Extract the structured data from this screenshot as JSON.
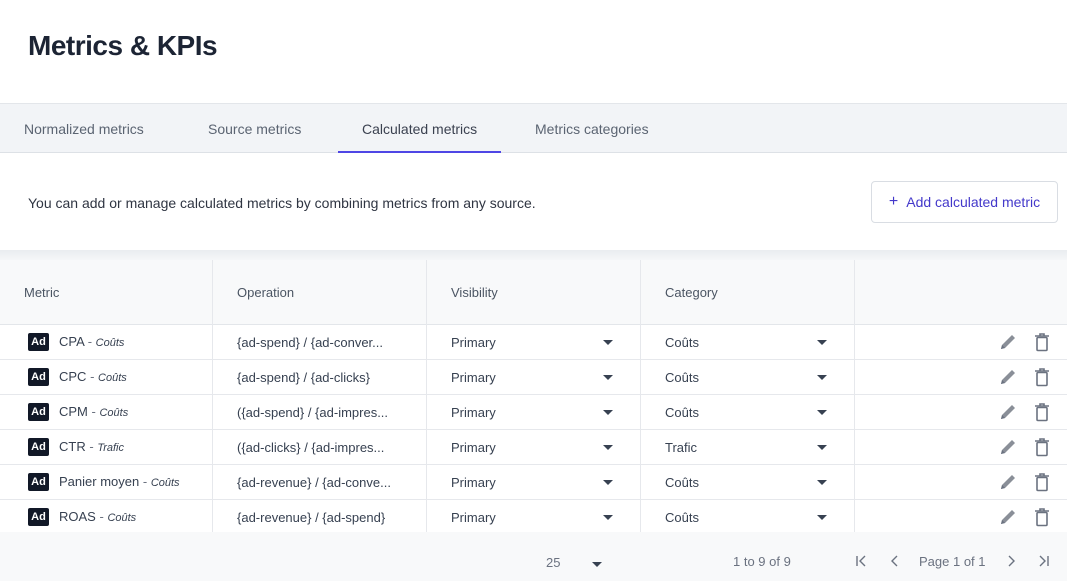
{
  "page": {
    "title": "Metrics & KPIs"
  },
  "tabs": [
    {
      "label": "Normalized metrics"
    },
    {
      "label": "Source metrics"
    },
    {
      "label": "Calculated metrics"
    },
    {
      "label": "Metrics categories"
    }
  ],
  "active_tab": "Calculated metrics",
  "description": "You can add or manage calculated metrics by combining metrics from any source.",
  "add_button": {
    "label": "Add calculated metric",
    "icon": "plus-icon"
  },
  "table": {
    "headers": {
      "metric": "Metric",
      "operation": "Operation",
      "visibility": "Visibility",
      "category": "Category"
    },
    "rows": [
      {
        "icon": "Ad",
        "name": "CPA",
        "sep": "-",
        "category_tag": "Coûts",
        "operation": "{ad-spend} / {ad-conver...",
        "visibility": "Primary",
        "category": "Coûts"
      },
      {
        "icon": "Ad",
        "name": "CPC",
        "sep": "-",
        "category_tag": "Coûts",
        "operation": "{ad-spend} / {ad-clicks}",
        "visibility": "Primary",
        "category": "Coûts"
      },
      {
        "icon": "Ad",
        "name": "CPM",
        "sep": "-",
        "category_tag": "Coûts",
        "operation": "({ad-spend} / {ad-impres...",
        "visibility": "Primary",
        "category": "Coûts"
      },
      {
        "icon": "Ad",
        "name": "CTR",
        "sep": "-",
        "category_tag": "Trafic",
        "operation": "({ad-clicks} / {ad-impres...",
        "visibility": "Primary",
        "category": "Trafic"
      },
      {
        "icon": "Ad",
        "name": "Panier moyen",
        "sep": "-",
        "category_tag": "Coûts",
        "operation": "{ad-revenue} / {ad-conve...",
        "visibility": "Primary",
        "category": "Coûts"
      },
      {
        "icon": "Ad",
        "name": "ROAS",
        "sep": "-",
        "category_tag": "Coûts",
        "operation": "{ad-revenue} / {ad-spend}",
        "visibility": "Primary",
        "category": "Coûts"
      }
    ]
  },
  "pagination": {
    "page_size": "25",
    "range": "1 to 9 of 9",
    "page_info": "Page 1 of 1"
  },
  "colors": {
    "accent": "#4f46e5",
    "title": "#1c2434",
    "icon_gray": "#6b7280"
  }
}
